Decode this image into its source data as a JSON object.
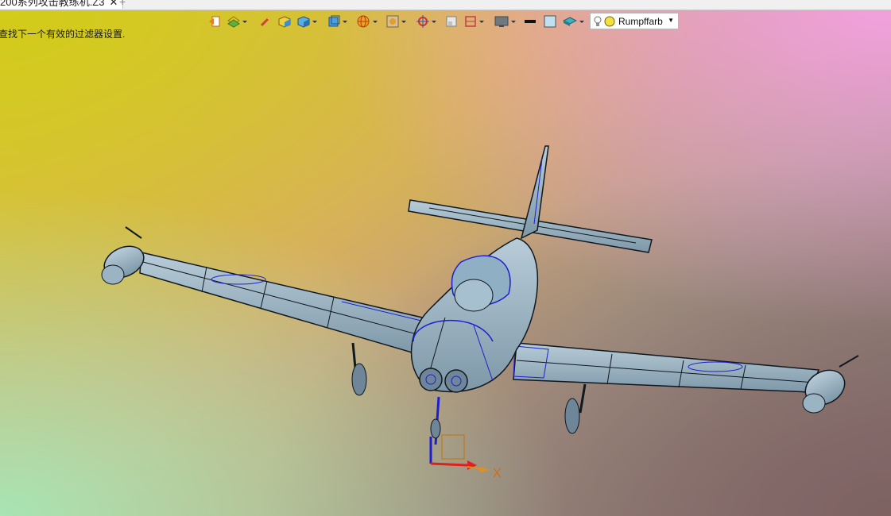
{
  "tabs": {
    "active_label": "200系列攻击教练机.Z3",
    "close_glyph": "✕",
    "new_tab_glyph": "+"
  },
  "status": {
    "message": "查找下一个有效的过滤器设置."
  },
  "toolbar": {
    "icons": [
      "import-icon",
      "layers-icon",
      "pen-icon",
      "solid-icon",
      "cube-icon",
      "view-cube-icon",
      "sphere-icon",
      "frame-icon",
      "target-icon",
      "box-icon",
      "section-icon",
      "display-icon",
      "line-color-icon",
      "fill-color-icon",
      "texture-icon",
      "bulb-icon"
    ],
    "render_mode": {
      "label": "Rumpffarb",
      "options_caret": "▼"
    }
  },
  "scene": {
    "object": "aircraft-wireframe-model",
    "axis_label": "X",
    "colors": {
      "edge": "#1e1ed0",
      "outline": "#101820",
      "surface": "#9ab4c4",
      "axis_x": "#e02020",
      "axis_arrow": "#e09020"
    }
  }
}
